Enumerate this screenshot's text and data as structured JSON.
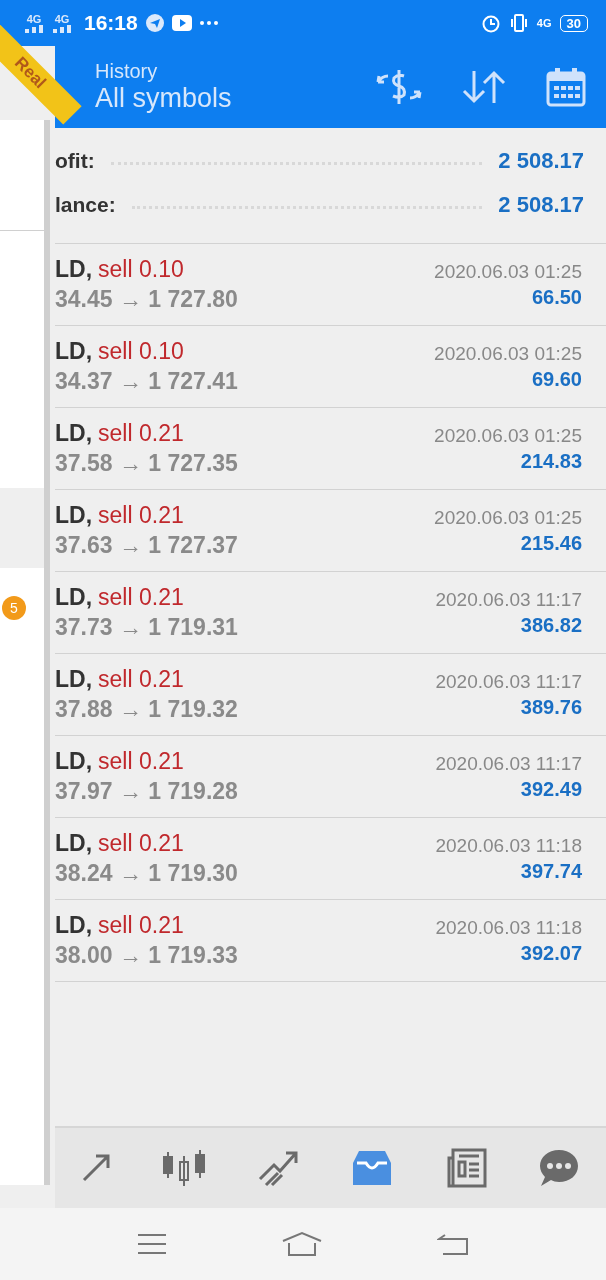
{
  "status_bar": {
    "signal_1": "4G",
    "signal_2": "4G",
    "time": "16:18",
    "network": "4G",
    "battery": "30"
  },
  "account_badge": "Real",
  "header": {
    "title": "History",
    "subtitle": "All symbols"
  },
  "drawer": {
    "badge": "5"
  },
  "summary": [
    {
      "label": "ofit:",
      "value": "2 508.17"
    },
    {
      "label": "lance:",
      "value": "2 508.17"
    }
  ],
  "trades": [
    {
      "symbol": "LD,",
      "type": "sell 0.10",
      "prices": "34.45 → 1 727.80",
      "time": "2020.06.03 01:25",
      "profit": "66.50"
    },
    {
      "symbol": "LD,",
      "type": "sell 0.10",
      "prices": "34.37 → 1 727.41",
      "time": "2020.06.03 01:25",
      "profit": "69.60"
    },
    {
      "symbol": "LD,",
      "type": "sell 0.21",
      "prices": "37.58 → 1 727.35",
      "time": "2020.06.03 01:25",
      "profit": "214.83"
    },
    {
      "symbol": "LD,",
      "type": "sell 0.21",
      "prices": "37.63 → 1 727.37",
      "time": "2020.06.03 01:25",
      "profit": "215.46"
    },
    {
      "symbol": "LD,",
      "type": "sell 0.21",
      "prices": "37.73 → 1 719.31",
      "time": "2020.06.03 11:17",
      "profit": "386.82"
    },
    {
      "symbol": "LD,",
      "type": "sell 0.21",
      "prices": "37.88 → 1 719.32",
      "time": "2020.06.03 11:17",
      "profit": "389.76"
    },
    {
      "symbol": "LD,",
      "type": "sell 0.21",
      "prices": "37.97 → 1 719.28",
      "time": "2020.06.03 11:17",
      "profit": "392.49"
    },
    {
      "symbol": "LD,",
      "type": "sell 0.21",
      "prices": "38.24 → 1 719.30",
      "time": "2020.06.03 11:18",
      "profit": "397.74"
    },
    {
      "symbol": "LD,",
      "type": "sell 0.21",
      "prices": "38.00 → 1 719.33",
      "time": "2020.06.03 11:18",
      "profit": "392.07"
    }
  ],
  "bottom_nav": [
    {
      "selected": false
    },
    {
      "selected": false
    },
    {
      "selected": false
    },
    {
      "selected": true
    },
    {
      "selected": false
    },
    {
      "selected": false
    }
  ]
}
